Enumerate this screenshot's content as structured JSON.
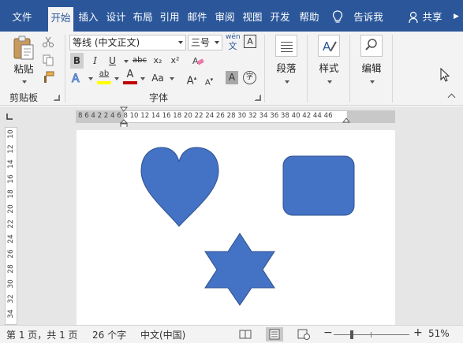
{
  "tabs": [
    {
      "label": "文件",
      "active": false
    },
    {
      "label": "开始",
      "active": true
    },
    {
      "label": "插入",
      "active": false
    },
    {
      "label": "设计",
      "active": false
    },
    {
      "label": "布局",
      "active": false
    },
    {
      "label": "引用",
      "active": false
    },
    {
      "label": "邮件",
      "active": false
    },
    {
      "label": "审阅",
      "active": false
    },
    {
      "label": "视图",
      "active": false
    },
    {
      "label": "开发",
      "active": false
    },
    {
      "label": "帮助",
      "active": false
    }
  ],
  "tell_me": "告诉我",
  "share": "共享",
  "clipboard": {
    "paste_label": "粘贴",
    "group_label": "剪贴板"
  },
  "font": {
    "font_name": "等线 (中文正文)",
    "font_size": "三号",
    "group_label": "字体",
    "wen_top": "wén",
    "wen_bottom": "文",
    "boxed_a": "A",
    "bold": "B",
    "italic": "I",
    "underline": "U",
    "strike": "abc",
    "subscript": "x₂",
    "superscript": "x²",
    "highlight": "ab",
    "font_color": "A",
    "change_case": "Aa",
    "grow": "A",
    "shrink": "A",
    "char_shade": "A",
    "enclose": "字"
  },
  "paragraph": {
    "label": "段落"
  },
  "styles": {
    "label": "样式"
  },
  "editing": {
    "label": "编辑"
  },
  "ruler": {
    "h_numbers": "8  6  4  2        2   4   6   8  10  12  14  16  18  20  22  24  26  28  30  32  34  36  38  40  42  44  46",
    "v_numbers": [
      "10",
      "12",
      "14",
      "16",
      "18",
      "20",
      "22",
      "24",
      "26",
      "28",
      "30",
      "32",
      "34"
    ]
  },
  "shapes": [
    {
      "name": "heart",
      "color": "#4472c4"
    },
    {
      "name": "rounded-rectangle",
      "color": "#4472c4"
    },
    {
      "name": "six-point-star",
      "color": "#4472c4"
    }
  ],
  "status": {
    "page": "第 1 页，共 1 页",
    "words": "26 个字",
    "language": "中文(中国)",
    "zoom_minus": "−",
    "zoom_plus": "+",
    "zoom": "51%"
  },
  "colors": {
    "accent": "#2b579a",
    "shape_fill": "#4472c4",
    "highlight_yellow": "#ffff00",
    "font_red": "#c00000"
  }
}
